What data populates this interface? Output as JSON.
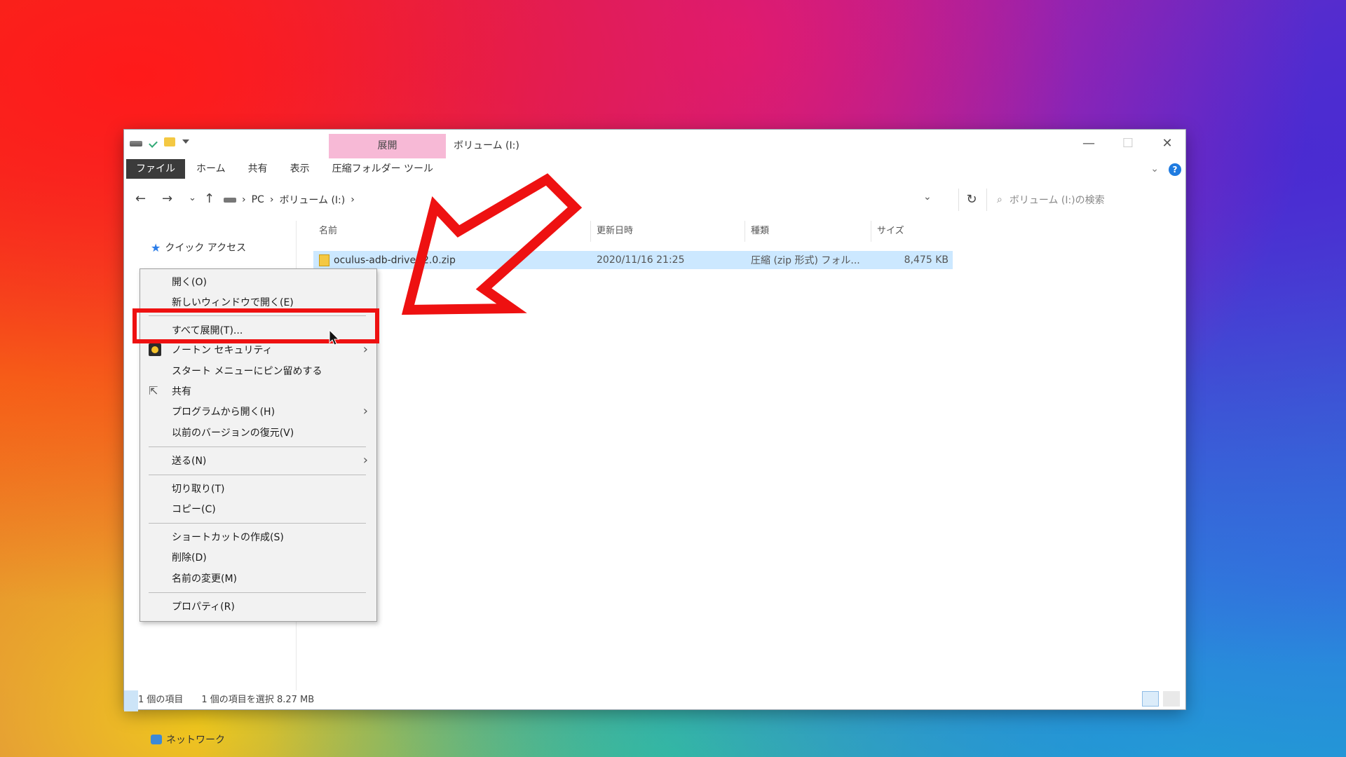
{
  "window": {
    "context_tab": "展開",
    "title": "ボリューム (I:)",
    "minimize": "—",
    "maximize": "☐",
    "close": "✕"
  },
  "ribbon": {
    "tabs": [
      "ファイル",
      "ホーム",
      "共有",
      "表示",
      "圧縮フォルダー ツール"
    ],
    "help": "?"
  },
  "address": {
    "back": "←",
    "forward": "→",
    "recent": "⌄",
    "up": "↑",
    "crumbs": [
      "PC",
      "ボリューム (I:)"
    ],
    "sep": "›",
    "refresh": "↻",
    "search_placeholder": "ボリューム (I:)の検索"
  },
  "nav_pane": {
    "quick_access": "クイック アクセス",
    "network": "ネットワーク"
  },
  "columns": [
    "名前",
    "更新日時",
    "種類",
    "サイズ"
  ],
  "file": {
    "name": "oculus-adb-driver-2.0.zip",
    "modified": "2020/11/16 21:25",
    "type": "圧縮 (zip 形式) フォル...",
    "size": "8,475 KB"
  },
  "status": {
    "items": "1 個の項目",
    "selected": "1 個の項目を選択  8.27 MB"
  },
  "context_menu": {
    "items": [
      "開く(O)",
      "新しいウィンドウで開く(E)",
      "すべて展開(T)...",
      "ノートン セキュリティ",
      "スタート メニューにピン留めする",
      "共有",
      "プログラムから開く(H)",
      "以前のバージョンの復元(V)",
      "送る(N)",
      "切り取り(T)",
      "コピー(C)",
      "ショートカットの作成(S)",
      "削除(D)",
      "名前の変更(M)",
      "プロパティ(R)"
    ],
    "submenu_arrow": "›"
  },
  "annotation": {
    "highlight_color": "#ee1111"
  }
}
